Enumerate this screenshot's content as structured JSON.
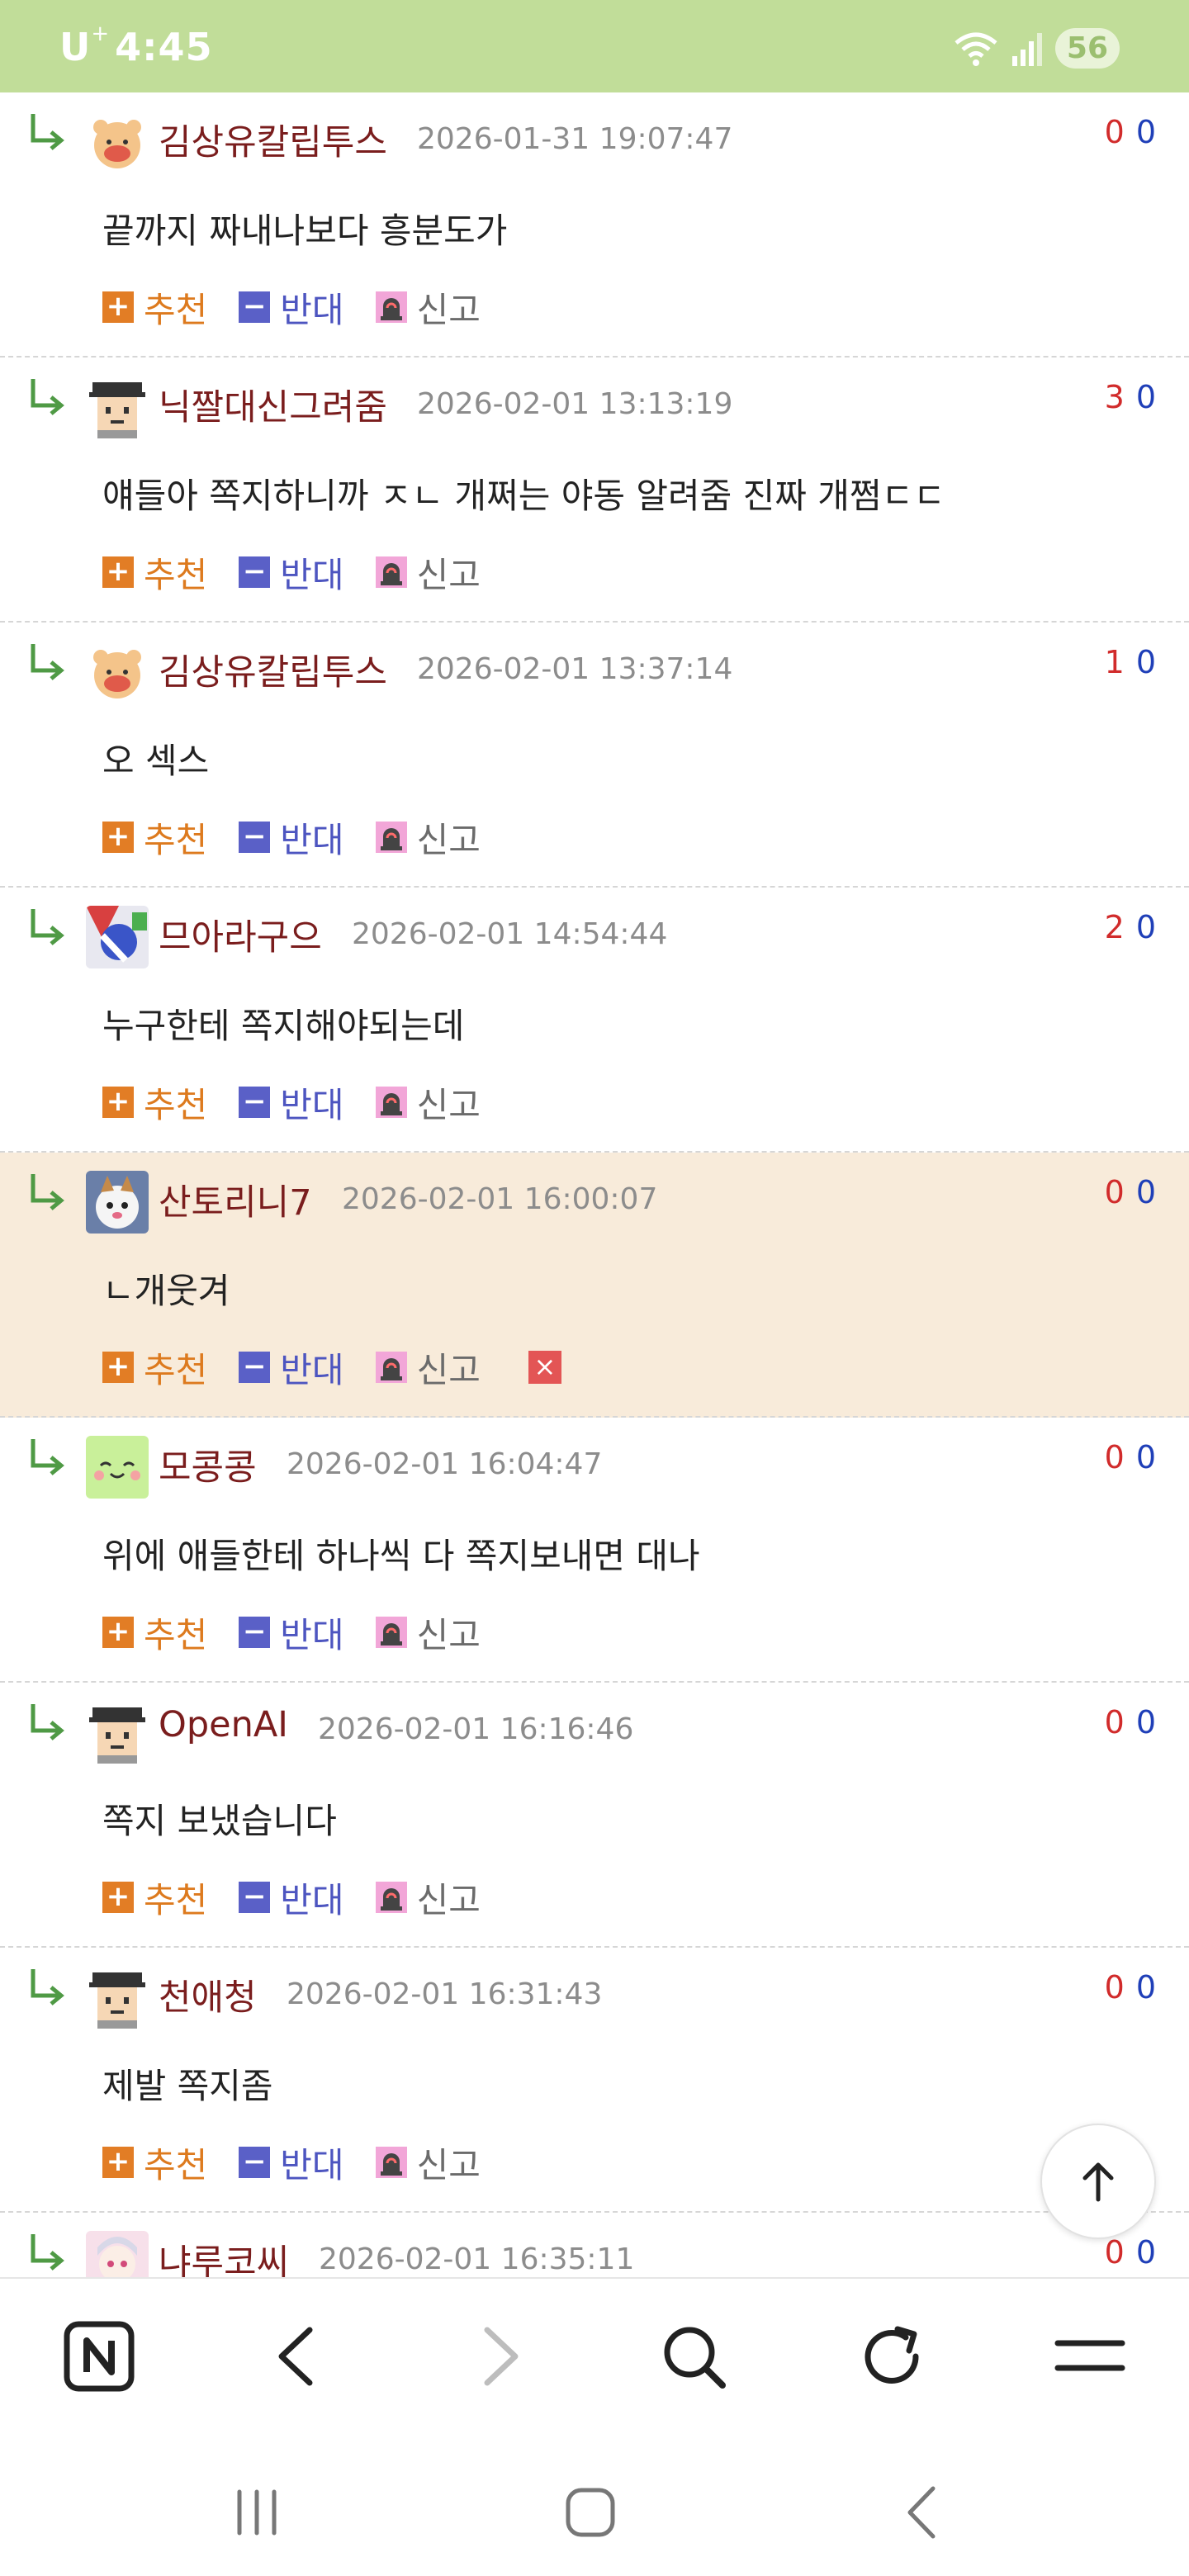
{
  "status_bar": {
    "carrier": "U",
    "carrier_sup": "+",
    "time": "4:45",
    "battery": "56"
  },
  "comments": [
    {
      "nick": "김상유칼립투스",
      "date": "2026-01-31 19:07:47",
      "up": "0",
      "down": "0",
      "text": "끝까지 짜내나보다 흥분도가",
      "avatar": "hamster-icon"
    },
    {
      "nick": "닉짤대신그려줌",
      "date": "2026-02-01 13:13:19",
      "up": "3",
      "down": "0",
      "text": "얘들아 쪽지하니까 ㅈㄴ 개쩌는 야동 알려줌 진짜 개쩜ㄷㄷ",
      "avatar": "pixel-face-icon"
    },
    {
      "nick": "김상유칼립투스",
      "date": "2026-02-01 13:37:14",
      "up": "1",
      "down": "0",
      "text": "오 섹스",
      "avatar": "hamster-icon"
    },
    {
      "nick": "므아라구으",
      "date": "2026-02-01 14:54:44",
      "up": "2",
      "down": "0",
      "text": "누구한테 쪽지해야되는데",
      "avatar": "colorful-avatar-icon"
    },
    {
      "nick": "산토리니7",
      "date": "2026-02-01 16:00:07",
      "up": "0",
      "down": "0",
      "text": "ㄴ개웃겨",
      "avatar": "cat-avatar-icon",
      "highlight": true
    },
    {
      "nick": "모콩콩",
      "date": "2026-02-01 16:04:47",
      "up": "0",
      "down": "0",
      "text": "위에 애들한테 하나씩 다 쪽지보내면 대나",
      "avatar": "green-face-icon"
    },
    {
      "nick": "OpenAI",
      "date": "2026-02-01 16:16:46",
      "up": "0",
      "down": "0",
      "text": "쪽지 보냈습니다",
      "avatar": "pixel-face-icon"
    },
    {
      "nick": "천애청",
      "date": "2026-02-01 16:31:43",
      "up": "0",
      "down": "0",
      "text": "제발 쪽지좀",
      "avatar": "pixel-face-icon"
    },
    {
      "nick": "냐루코씨",
      "date": "2026-02-01 16:35:11",
      "up": "0",
      "down": "0",
      "text": "",
      "avatar": "anime-avatar-icon"
    }
  ],
  "actions": {
    "recommend": "추천",
    "oppose": "반대",
    "report": "신고"
  },
  "toolbar": {
    "items": [
      "naver-n-icon",
      "back-icon",
      "forward-icon",
      "search-icon",
      "refresh-icon",
      "menu-icon"
    ]
  },
  "colors": {
    "status_bar": "#c1dd99",
    "nickname": "#7a1d1d",
    "upvote": "#d12b2b",
    "downvote": "#1f3fb8",
    "highlight_row": "#f8ebda"
  }
}
